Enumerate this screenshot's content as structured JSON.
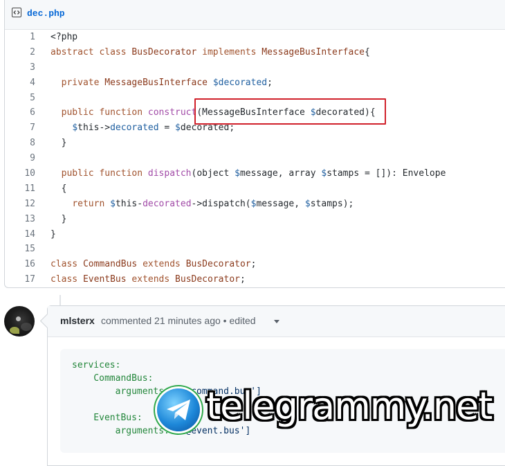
{
  "file": {
    "name": "dec.php",
    "lines": [
      {
        "n": "1",
        "html": "&lt;?php"
      },
      {
        "n": "2",
        "html": "<span class=\"kw\">abstract class</span> <span class=\"ty\">BusDecorator</span> <span class=\"kw\">implements</span> <span class=\"ty\">MessageBusInterface</span>{"
      },
      {
        "n": "3",
        "html": ""
      },
      {
        "n": "4",
        "html": "  <span class=\"kw\">private</span> <span class=\"ty\">MessageBusInterface</span> <span class=\"var\">$decorated</span>;"
      },
      {
        "n": "5",
        "html": ""
      },
      {
        "n": "6",
        "html": "  <span class=\"kw\">public function</span> <span class=\"fn\">construct</span>(MessageBusInterface <span class=\"var\">$</span>decorated){"
      },
      {
        "n": "7",
        "html": "    <span class=\"var\">$</span>this-&gt;<span class=\"var\">decorated</span> = <span class=\"var\">$</span>decorated;"
      },
      {
        "n": "8",
        "html": "  }"
      },
      {
        "n": "9",
        "html": ""
      },
      {
        "n": "10",
        "html": "  <span class=\"kw\">public function</span> <span class=\"fn\">dispatch</span>(object <span class=\"var\">$</span>message, array <span class=\"var\">$</span>stamps = []): Envelope"
      },
      {
        "n": "11",
        "html": "  {"
      },
      {
        "n": "12",
        "html": "    <span class=\"kw\">return</span> <span class=\"var\">$</span>this-<span class=\"fn\">decorated</span>-&gt;dispatch(<span class=\"var\">$</span>message, <span class=\"var\">$</span>stamps);"
      },
      {
        "n": "13",
        "html": "  }"
      },
      {
        "n": "14",
        "html": "}"
      },
      {
        "n": "15",
        "html": ""
      },
      {
        "n": "16",
        "html": "<span class=\"kw\">class</span> <span class=\"ty\">CommandBus</span> <span class=\"kw\">extends</span> <span class=\"ty\">BusDecorator</span>;"
      },
      {
        "n": "17",
        "html": "<span class=\"kw\">class</span> <span class=\"ty\">EventBus</span> <span class=\"kw\">extends</span> <span class=\"ty\">BusDecorator</span>;"
      }
    ]
  },
  "comment": {
    "author": "mlsterx",
    "meta": "commented 21 minutes ago • edited",
    "yaml": [
      {
        "text": "services:"
      },
      {
        "text": "    CommandBus:"
      },
      {
        "text": "        arguments: ['@command.bus']"
      },
      {
        "text": ""
      },
      {
        "text": "    EventBus:"
      },
      {
        "text": "        arguments: ['@event.bus']"
      }
    ]
  },
  "watermark": {
    "text": "telegrammy.net"
  },
  "colors": {
    "link": "#0366d6",
    "highlight": "#d0202a",
    "keyword": "#a0522d",
    "variable": "#1f5fa0"
  }
}
